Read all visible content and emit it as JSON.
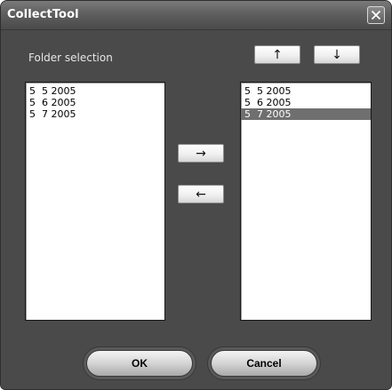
{
  "window": {
    "title": "CollectTool",
    "close_icon": "close-icon"
  },
  "folder_selection": {
    "label": "Folder selection"
  },
  "left_list": {
    "items": [
      "5  5 2005",
      "5  6 2005",
      "5  7 2005"
    ]
  },
  "right_list": {
    "items": [
      "5  5 2005",
      "5  6 2005",
      "5  7 2005"
    ],
    "selected_index": 2
  },
  "buttons": {
    "move_up": "↑",
    "move_down": "↓",
    "add": "→",
    "remove": "←",
    "ok": "OK",
    "cancel": "Cancel"
  },
  "colors": {
    "window_bg": "#4a4a4a",
    "selection_bg": "#6f6f6f"
  }
}
